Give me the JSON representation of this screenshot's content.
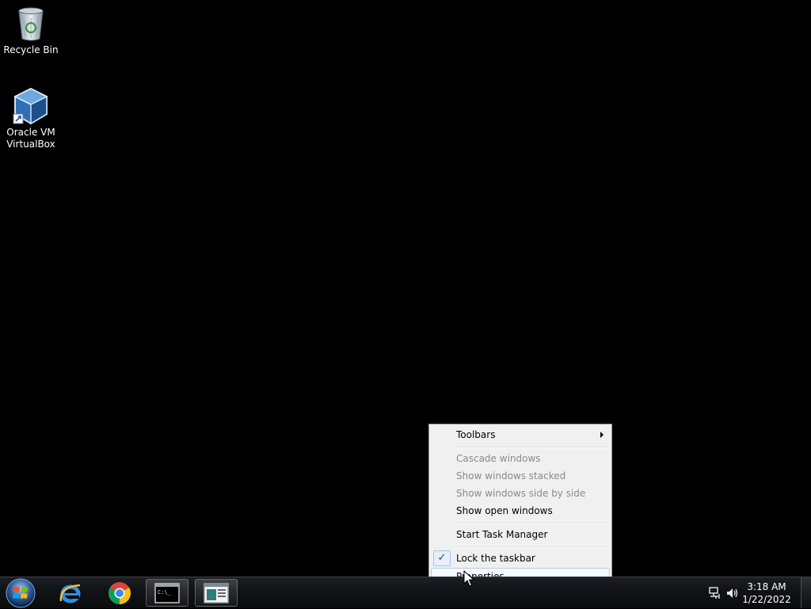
{
  "desktop": {
    "icons": [
      {
        "label": "Recycle Bin",
        "icon": "recycle-bin-icon"
      },
      {
        "label": "Oracle VM\nVirtualBox",
        "icon": "virtualbox-icon"
      }
    ]
  },
  "context_menu": {
    "items": [
      {
        "label": "Toolbars",
        "enabled": true,
        "submenu": true
      },
      {
        "label": "Cascade windows",
        "enabled": false
      },
      {
        "label": "Show windows stacked",
        "enabled": false
      },
      {
        "label": "Show windows side by side",
        "enabled": false
      },
      {
        "label": "Show open windows",
        "enabled": true
      },
      {
        "label": "Start Task Manager",
        "enabled": true
      },
      {
        "label": "Lock the taskbar",
        "enabled": true,
        "checked": true,
        "check_glyph": "✓"
      },
      {
        "label": "Properties",
        "enabled": true,
        "highlighted": true
      }
    ]
  },
  "taskbar": {
    "pinned": [
      {
        "icon": "start-orb-icon"
      },
      {
        "icon": "internet-explorer-icon"
      },
      {
        "icon": "chrome-icon"
      },
      {
        "icon": "command-prompt-icon",
        "open": true,
        "caption": "C:\\_"
      },
      {
        "icon": "app-window-icon",
        "open": true
      }
    ],
    "tray": {
      "network_icon": "network-icon",
      "volume_icon": "volume-icon",
      "time": "3:18 AM",
      "date": "1/22/2022"
    }
  },
  "colors": {
    "desktop_bg": "#000000",
    "menu_bg": "#f0f0f0",
    "menu_hover_border": "#aeccf0",
    "disabled_text": "#8a8a8a"
  }
}
